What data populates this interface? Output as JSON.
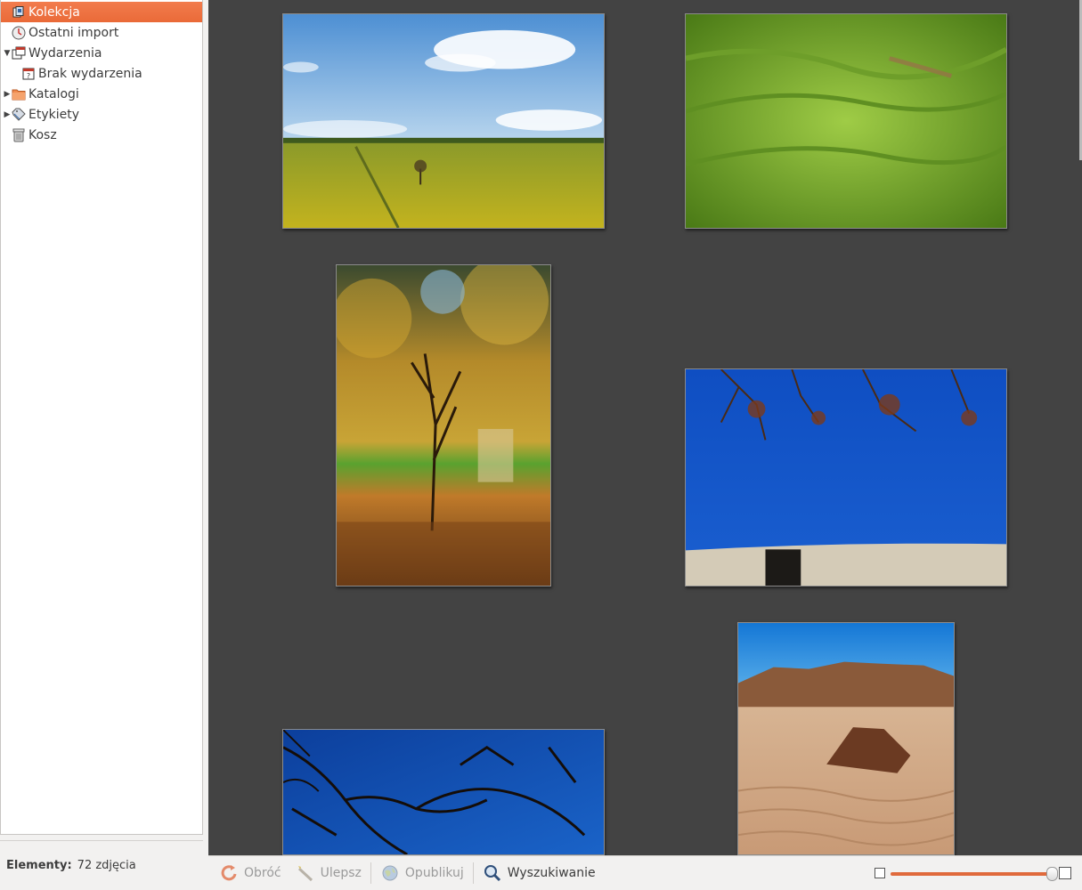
{
  "sidebar": {
    "items": [
      {
        "label": "Kolekcja",
        "icon": "library-icon",
        "selected": true
      },
      {
        "label": "Ostatni import",
        "icon": "last-import-icon"
      },
      {
        "label": "Wydarzenia",
        "icon": "events-icon",
        "expanded": true
      },
      {
        "label": "Brak wydarzenia",
        "icon": "no-event-icon",
        "child": true
      },
      {
        "label": "Katalogi",
        "icon": "folder-icon",
        "collapsed": true
      },
      {
        "label": "Etykiety",
        "icon": "tag-icon",
        "collapsed": true
      },
      {
        "label": "Kosz",
        "icon": "trash-icon"
      }
    ]
  },
  "status": {
    "label": "Elementy:",
    "value": "72 zdjęcia"
  },
  "toolbar": {
    "rotate_label": "Obróć",
    "enhance_label": "Ulepsz",
    "publish_label": "Opublikuj",
    "search_label": "Wyszukiwanie"
  },
  "zoom": {
    "level": 0.98
  },
  "colors": {
    "accent": "#ea6a38",
    "grid_bg": "#434343"
  }
}
